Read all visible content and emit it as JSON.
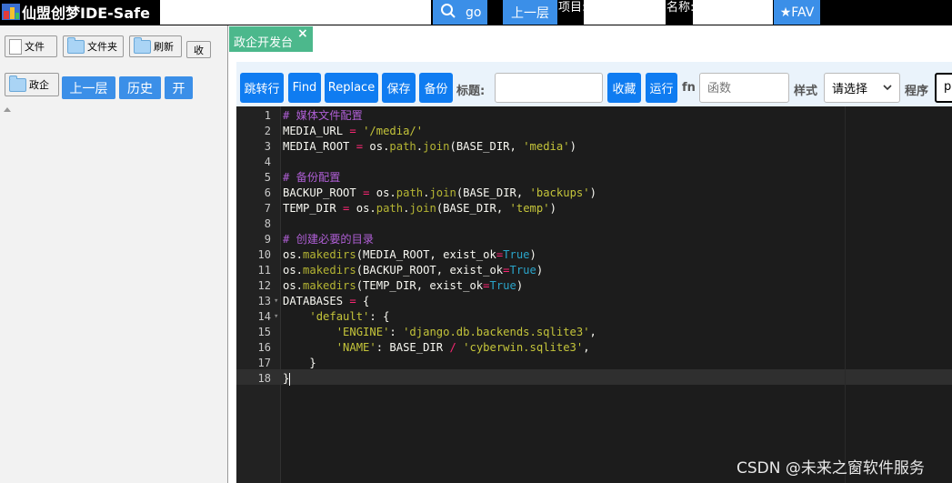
{
  "app_title": "仙盟创梦IDE-Safe",
  "topbar": {
    "path_value": "",
    "search_label": "go",
    "up_label": "上一层",
    "project_label": "项目:",
    "project_value": "",
    "name_label": "名称:",
    "name_value": "",
    "fav_label": "★FAV"
  },
  "sidebar": {
    "row1": [
      "文件",
      "文件夹",
      "刷新",
      "收"
    ],
    "folder_label": "政企",
    "row2": [
      "上一层",
      "历史",
      "开"
    ]
  },
  "tab": {
    "label": "政企开发台",
    "close": "×"
  },
  "toolbar": {
    "buttons": [
      "跳转行",
      "Find",
      "Replace",
      "保存",
      "备份"
    ],
    "title_label": "标题:",
    "title_value": "",
    "fav_button": "收藏",
    "run_button": "运行",
    "fn_label": "fn",
    "fn_placeholder": "函数",
    "style_label": "样式",
    "style_selected": "请选择",
    "program_label": "程序",
    "program_value": "p"
  },
  "editor": {
    "line_numbers": [
      "1",
      "2",
      "3",
      "4",
      "5",
      "6",
      "7",
      "8",
      "9",
      "10",
      "11",
      "12",
      "13",
      "14",
      "15",
      "16",
      "17",
      "18"
    ],
    "fold_markers": {
      "13": "▾",
      "14": "▾"
    },
    "lines": [
      "# 媒体文件配置",
      "MEDIA_URL = '/media/'",
      "MEDIA_ROOT = os.path.join(BASE_DIR, 'media')",
      "",
      "# 备份配置",
      "BACKUP_ROOT = os.path.join(BASE_DIR, 'backups')",
      "TEMP_DIR = os.path.join(BASE_DIR, 'temp')",
      "",
      "# 创建必要的目录",
      "os.makedirs(MEDIA_ROOT, exist_ok=True)",
      "os.makedirs(BACKUP_ROOT, exist_ok=True)",
      "os.makedirs(TEMP_DIR, exist_ok=True)",
      "DATABASES = {",
      "    'default': {",
      "        'ENGINE': 'django.db.backends.sqlite3',",
      "        'NAME': BASE_DIR / 'cyberwin.sqlite3',",
      "    }",
      "}"
    ],
    "active_line": 18
  },
  "watermark": "CSDN @未来之窗软件服务"
}
